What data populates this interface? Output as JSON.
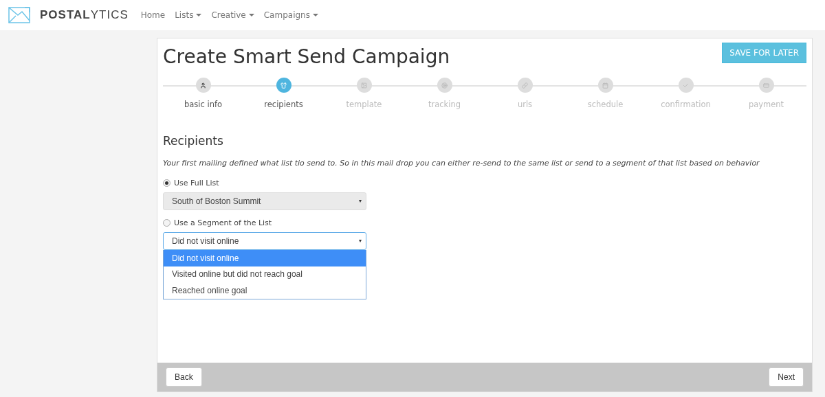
{
  "brand": {
    "name": "**POSTAL**YTICS"
  },
  "nav": [
    {
      "label": "Home",
      "dropdown": false
    },
    {
      "label": "Lists",
      "dropdown": true
    },
    {
      "label": "Creative",
      "dropdown": true
    },
    {
      "label": "Campaigns",
      "dropdown": true
    }
  ],
  "page": {
    "title": "Create Smart Send Campaign",
    "save_button": "SAVE FOR LATER"
  },
  "steps": [
    {
      "label": "basic info",
      "selected": false,
      "completed": true
    },
    {
      "label": "recipients",
      "selected": true,
      "completed": false
    },
    {
      "label": "template",
      "selected": false,
      "completed": false
    },
    {
      "label": "tracking",
      "selected": false,
      "completed": false
    },
    {
      "label": "urls",
      "selected": false,
      "completed": false
    },
    {
      "label": "schedule",
      "selected": false,
      "completed": false
    },
    {
      "label": "confirmation",
      "selected": false,
      "completed": false
    },
    {
      "label": "payment",
      "selected": false,
      "completed": false
    }
  ],
  "section": {
    "heading": "Recipients",
    "description": "Your first mailing defined what list tio send to. So in this mail drop you can either re-send to the same list or send to a segment of that list based on behavior"
  },
  "options": [
    {
      "label": "Use Full List",
      "selected": true,
      "select": {
        "value": "South of Boston Summit",
        "disabled": true,
        "expanded": false
      }
    },
    {
      "label": "Use a Segment of the List",
      "selected": false,
      "select": {
        "value": "Did not visit online",
        "disabled": false,
        "expanded": true,
        "menu": [
          {
            "label": "Did not visit online",
            "selected": true
          },
          {
            "label": "Visited online but did not reach goal",
            "selected": false
          },
          {
            "label": "Reached online goal",
            "selected": false
          }
        ]
      }
    }
  ],
  "footer": {
    "back": "Back",
    "next": "Next"
  }
}
